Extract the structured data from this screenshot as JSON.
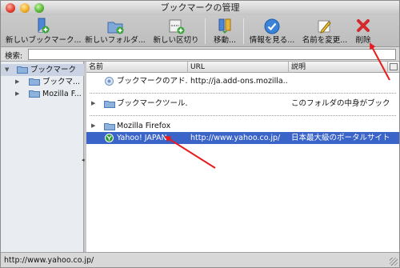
{
  "window": {
    "title": "ブックマークの管理"
  },
  "toolbar": {
    "new_bookmark": "新しいブックマーク...",
    "new_folder": "新しいフォルダ...",
    "new_separator": "新しい区切り",
    "move": "移動...",
    "properties": "情報を見る...",
    "rename": "名前を変更...",
    "delete": "削除"
  },
  "search": {
    "label": "検索:",
    "value": ""
  },
  "tree": {
    "items": [
      {
        "label": "ブックマーク"
      },
      {
        "label": "ブックマ..."
      },
      {
        "label": "Mozilla F..."
      }
    ]
  },
  "columns": {
    "name": "名前",
    "url": "URL",
    "description": "説明"
  },
  "rows": [
    {
      "name": "ブックマークのアド...",
      "url": "http://ja.add-ons.mozilla....",
      "description": ""
    },
    {
      "name": "ブックマークツール...",
      "url": "",
      "description": "このフォルダの中身がブック..."
    },
    {
      "name": "Mozilla Firefox",
      "url": "",
      "description": ""
    },
    {
      "name": "Yahoo! JAPAN",
      "url": "http://www.yahoo.co.jp/",
      "description": "日本最大級のポータルサイト..."
    }
  ],
  "status": {
    "text": "http://www.yahoo.co.jp/"
  },
  "colors": {
    "selection": "#3a64c8",
    "annotation_arrow": "#e81c1c"
  }
}
